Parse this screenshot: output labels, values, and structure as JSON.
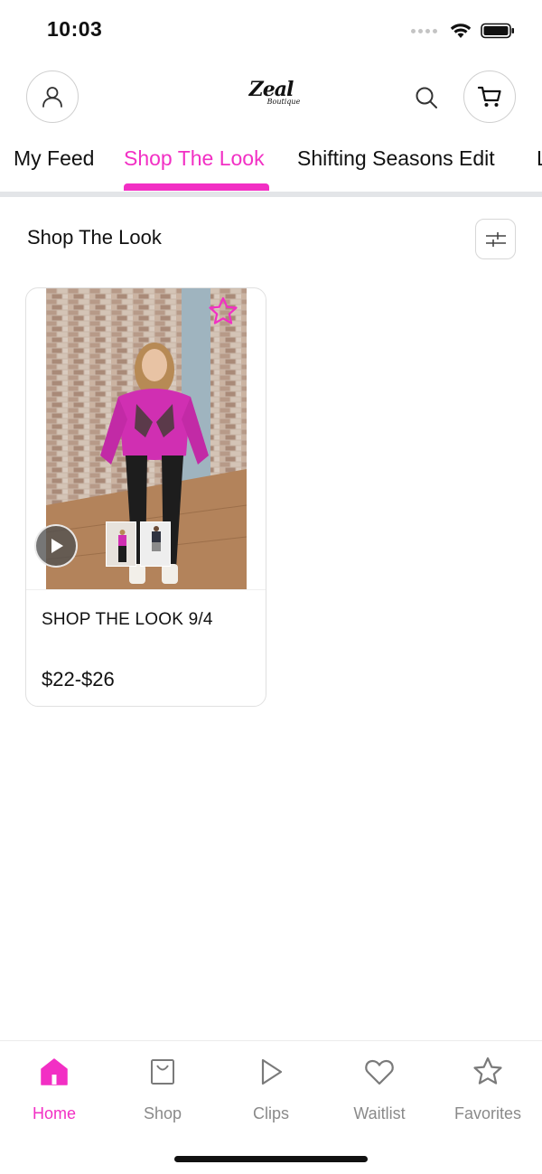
{
  "status_bar": {
    "time": "10:03"
  },
  "header": {
    "logo_main": "Zeal",
    "logo_sub": "Boutique",
    "icons": [
      "profile-icon",
      "search-icon",
      "cart-icon"
    ]
  },
  "tabs": [
    {
      "label": "My Feed",
      "active": false
    },
    {
      "label": "Shop The Look",
      "active": true
    },
    {
      "label": "Shifting Seasons Edit",
      "active": false
    },
    {
      "label": "L",
      "active": false
    }
  ],
  "colors": {
    "accent": "#f22fc4",
    "text": "#111111",
    "muted": "#8a8a8a",
    "divider": "#e3e5e8"
  },
  "section": {
    "title": "Shop The Look",
    "filter_icon": "sliders-icon"
  },
  "products": [
    {
      "title": "SHOP THE LOOK 9/4",
      "price": "$22-$26",
      "favorite_icon": "star-icon",
      "media_icon": "play-icon"
    }
  ],
  "bottom_nav": [
    {
      "label": "Home",
      "icon": "home-icon",
      "active": true
    },
    {
      "label": "Shop",
      "icon": "shopping-bag-icon",
      "active": false
    },
    {
      "label": "Clips",
      "icon": "play-outline-icon",
      "active": false
    },
    {
      "label": "Waitlist",
      "icon": "heart-icon",
      "active": false
    },
    {
      "label": "Favorites",
      "icon": "star-outline-icon",
      "active": false
    }
  ]
}
